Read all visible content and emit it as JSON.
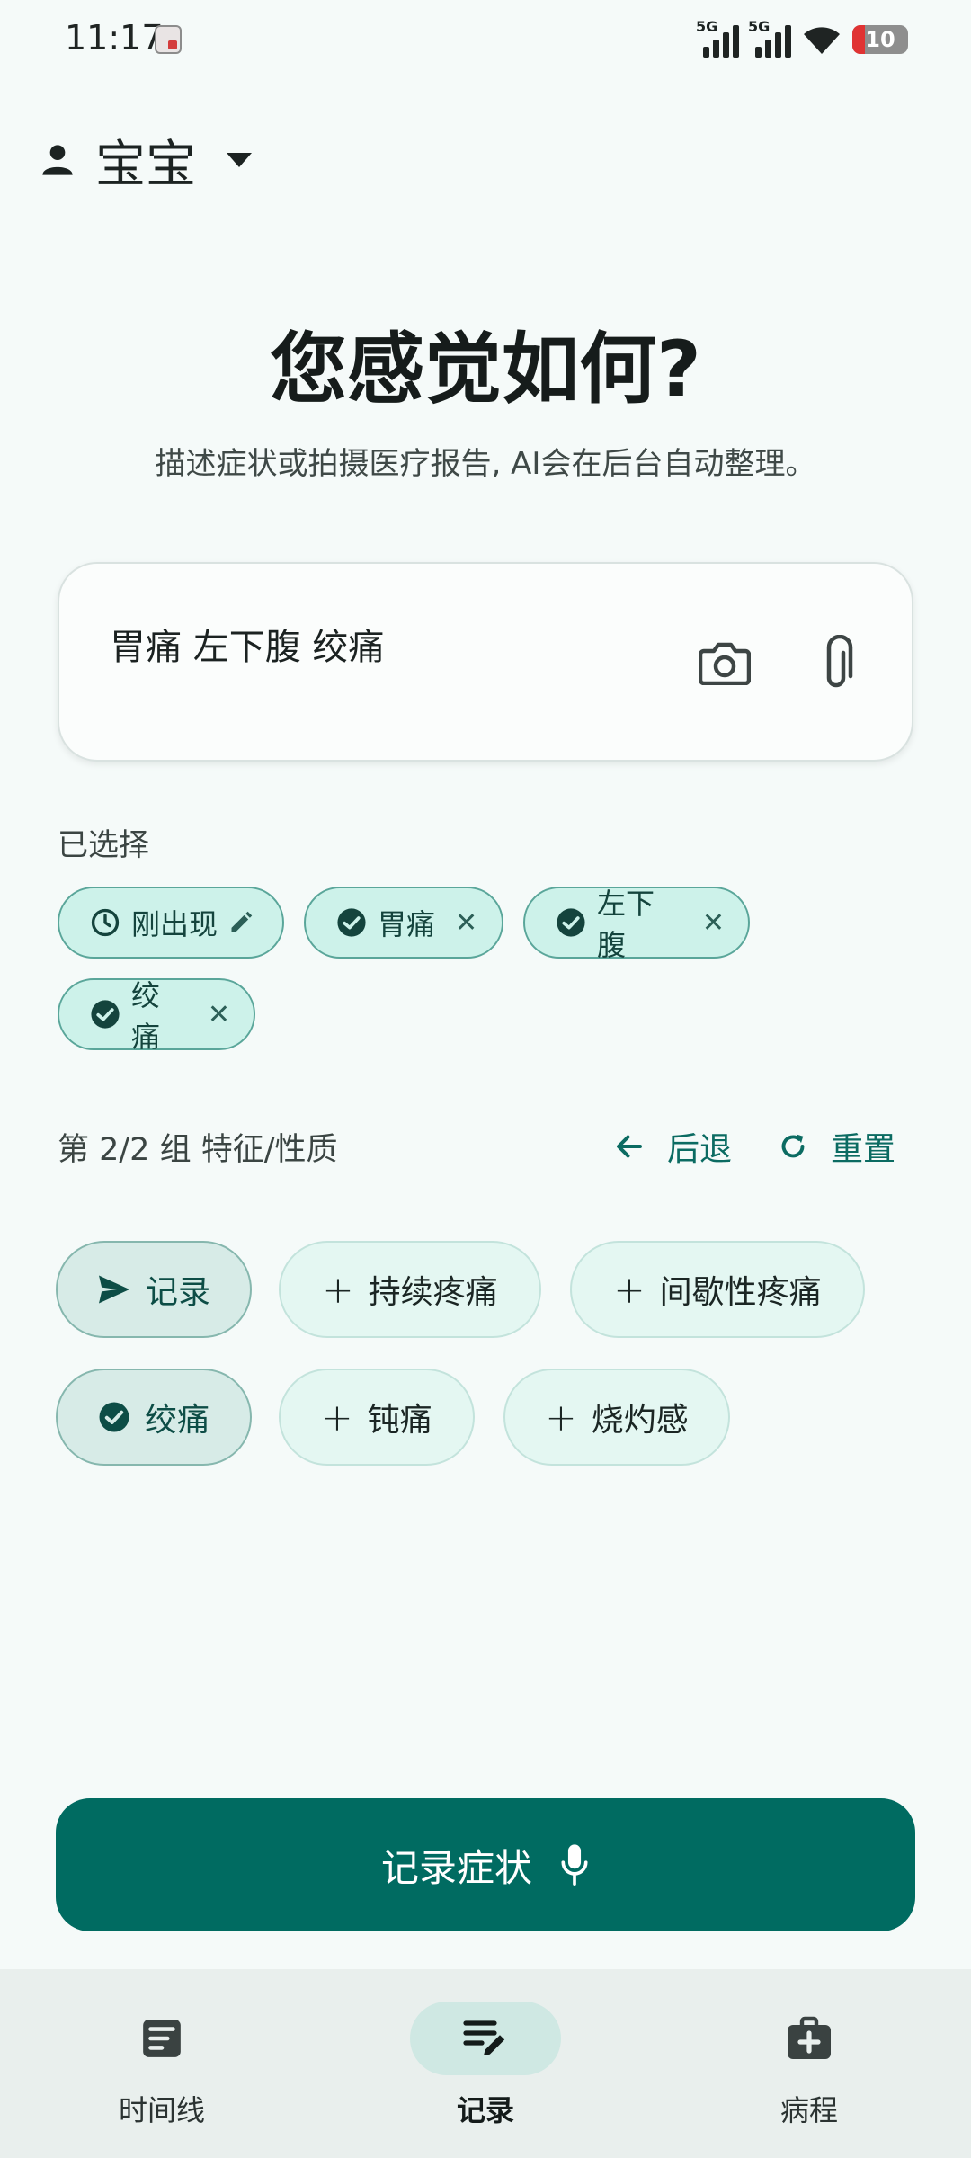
{
  "status_bar": {
    "time": "11:17",
    "network_1": "5G",
    "network_2": "5G",
    "battery": "10"
  },
  "profile": {
    "name": "宝宝"
  },
  "header": {
    "title": "您感觉如何?",
    "subtitle": "描述症状或拍摄医疗报告, AI会在后台自动整理。"
  },
  "input": {
    "value": "胃痛 左下腹 绞痛"
  },
  "selected": {
    "label": "已选择",
    "chips": [
      {
        "label": "刚出现",
        "icon": "clock-icon",
        "action": "edit-icon"
      },
      {
        "label": "胃痛",
        "icon": "check-circle-icon",
        "action": "close-icon"
      },
      {
        "label": "左下腹",
        "icon": "check-circle-icon",
        "action": "close-icon"
      },
      {
        "label": "绞痛",
        "icon": "check-circle-icon",
        "action": "close-icon"
      }
    ]
  },
  "group": {
    "label": "第 2/2 组 特征/性质",
    "back_label": "后退",
    "reset_label": "重置"
  },
  "options": [
    {
      "label": "记录",
      "state": "selected",
      "icon": "send-icon"
    },
    {
      "label": "持续疼痛",
      "state": "add",
      "icon": "plus-icon"
    },
    {
      "label": "间歇性疼痛",
      "state": "add",
      "icon": "plus-icon"
    },
    {
      "label": "绞痛",
      "state": "selected",
      "icon": "check-circle-icon"
    },
    {
      "label": "钝痛",
      "state": "add",
      "icon": "plus-icon"
    },
    {
      "label": "烧灼感",
      "state": "add",
      "icon": "plus-icon"
    }
  ],
  "cta": {
    "label": "记录症状"
  },
  "nav": {
    "items": [
      {
        "label": "时间线",
        "icon": "timeline-icon"
      },
      {
        "label": "记录",
        "icon": "notes-edit-icon",
        "active": true
      },
      {
        "label": "病程",
        "icon": "medical-kit-icon"
      }
    ]
  },
  "colors": {
    "primary": "#006b61",
    "chip_bg": "#cdf2ea",
    "chip_border": "#5aa69a",
    "background": "#f5faf9",
    "accent_text": "#0b6b62"
  }
}
